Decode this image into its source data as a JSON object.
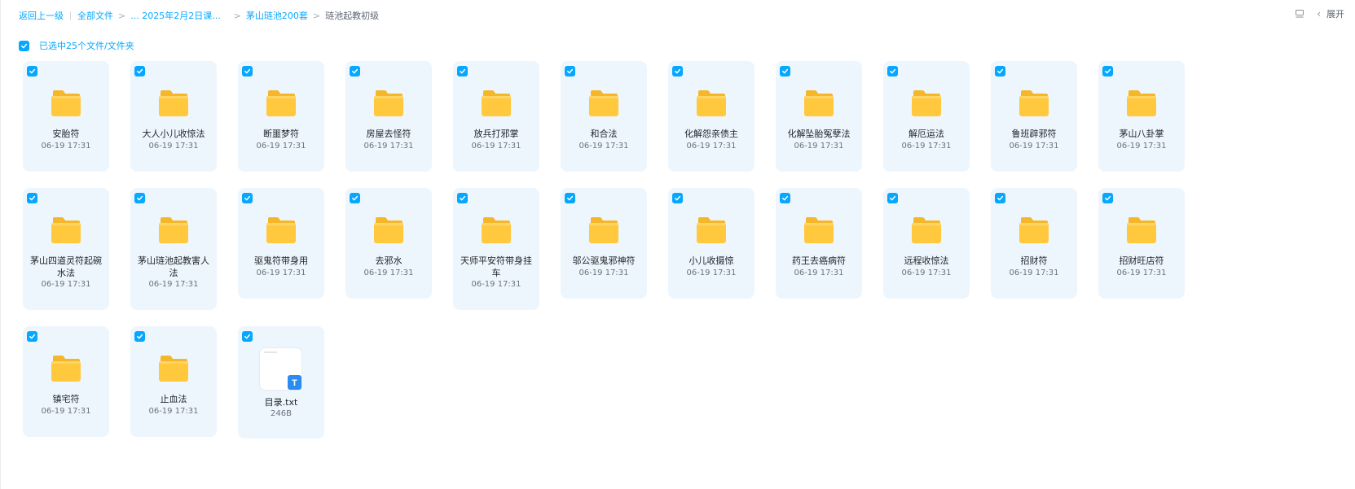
{
  "breadcrumb": {
    "back": "返回上一级",
    "all_files": "全部文件",
    "folder1": "... 2025年2月2日课...",
    "folder2": "茅山琏池200套",
    "current": "琏池起教初级"
  },
  "toolbar": {
    "expand_label": "展开"
  },
  "selection": {
    "label": "已选中25个文件/文件夹"
  },
  "colors": {
    "accent": "#06a7ff",
    "card_bg": "#eef6fd",
    "folder": "#ffc83d"
  },
  "items": [
    {
      "name": "安胎符",
      "date": "06-19 17:31",
      "type": "folder"
    },
    {
      "name": "大人小儿收惊法",
      "date": "06-19 17:31",
      "type": "folder"
    },
    {
      "name": "断噩梦符",
      "date": "06-19 17:31",
      "type": "folder"
    },
    {
      "name": "房屋去怪符",
      "date": "06-19 17:31",
      "type": "folder"
    },
    {
      "name": "放兵打邪掌",
      "date": "06-19 17:31",
      "type": "folder"
    },
    {
      "name": "和合法",
      "date": "06-19 17:31",
      "type": "folder"
    },
    {
      "name": "化解怨亲债主",
      "date": "06-19 17:31",
      "type": "folder"
    },
    {
      "name": "化解坠胎冤孽法",
      "date": "06-19 17:31",
      "type": "folder"
    },
    {
      "name": "解厄运法",
      "date": "06-19 17:31",
      "type": "folder"
    },
    {
      "name": "鲁班辟邪符",
      "date": "06-19 17:31",
      "type": "folder"
    },
    {
      "name": "茅山八卦掌",
      "date": "06-19 17:31",
      "type": "folder"
    },
    {
      "name": "茅山四道灵符起碗水法",
      "date": "06-19 17:31",
      "type": "folder"
    },
    {
      "name": "茅山琏池起教害人法",
      "date": "06-19 17:31",
      "type": "folder"
    },
    {
      "name": "驱鬼符带身用",
      "date": "06-19 17:31",
      "type": "folder"
    },
    {
      "name": "去邪水",
      "date": "06-19 17:31",
      "type": "folder"
    },
    {
      "name": "天师平安符带身挂车",
      "date": "06-19 17:31",
      "type": "folder"
    },
    {
      "name": "邬公驱鬼邪神符",
      "date": "06-19 17:31",
      "type": "folder"
    },
    {
      "name": "小儿收摄惊",
      "date": "06-19 17:31",
      "type": "folder"
    },
    {
      "name": "药王去癌病符",
      "date": "06-19 17:31",
      "type": "folder"
    },
    {
      "name": "远程收惊法",
      "date": "06-19 17:31",
      "type": "folder"
    },
    {
      "name": "招财符",
      "date": "06-19 17:31",
      "type": "folder"
    },
    {
      "name": "招财旺店符",
      "date": "06-19 17:31",
      "type": "folder"
    },
    {
      "name": "镇宅符",
      "date": "06-19 17:31",
      "type": "folder"
    },
    {
      "name": "止血法",
      "date": "06-19 17:31",
      "type": "folder"
    },
    {
      "name": "目录.txt",
      "date": "246B",
      "type": "txt",
      "file_badge": "T"
    }
  ]
}
